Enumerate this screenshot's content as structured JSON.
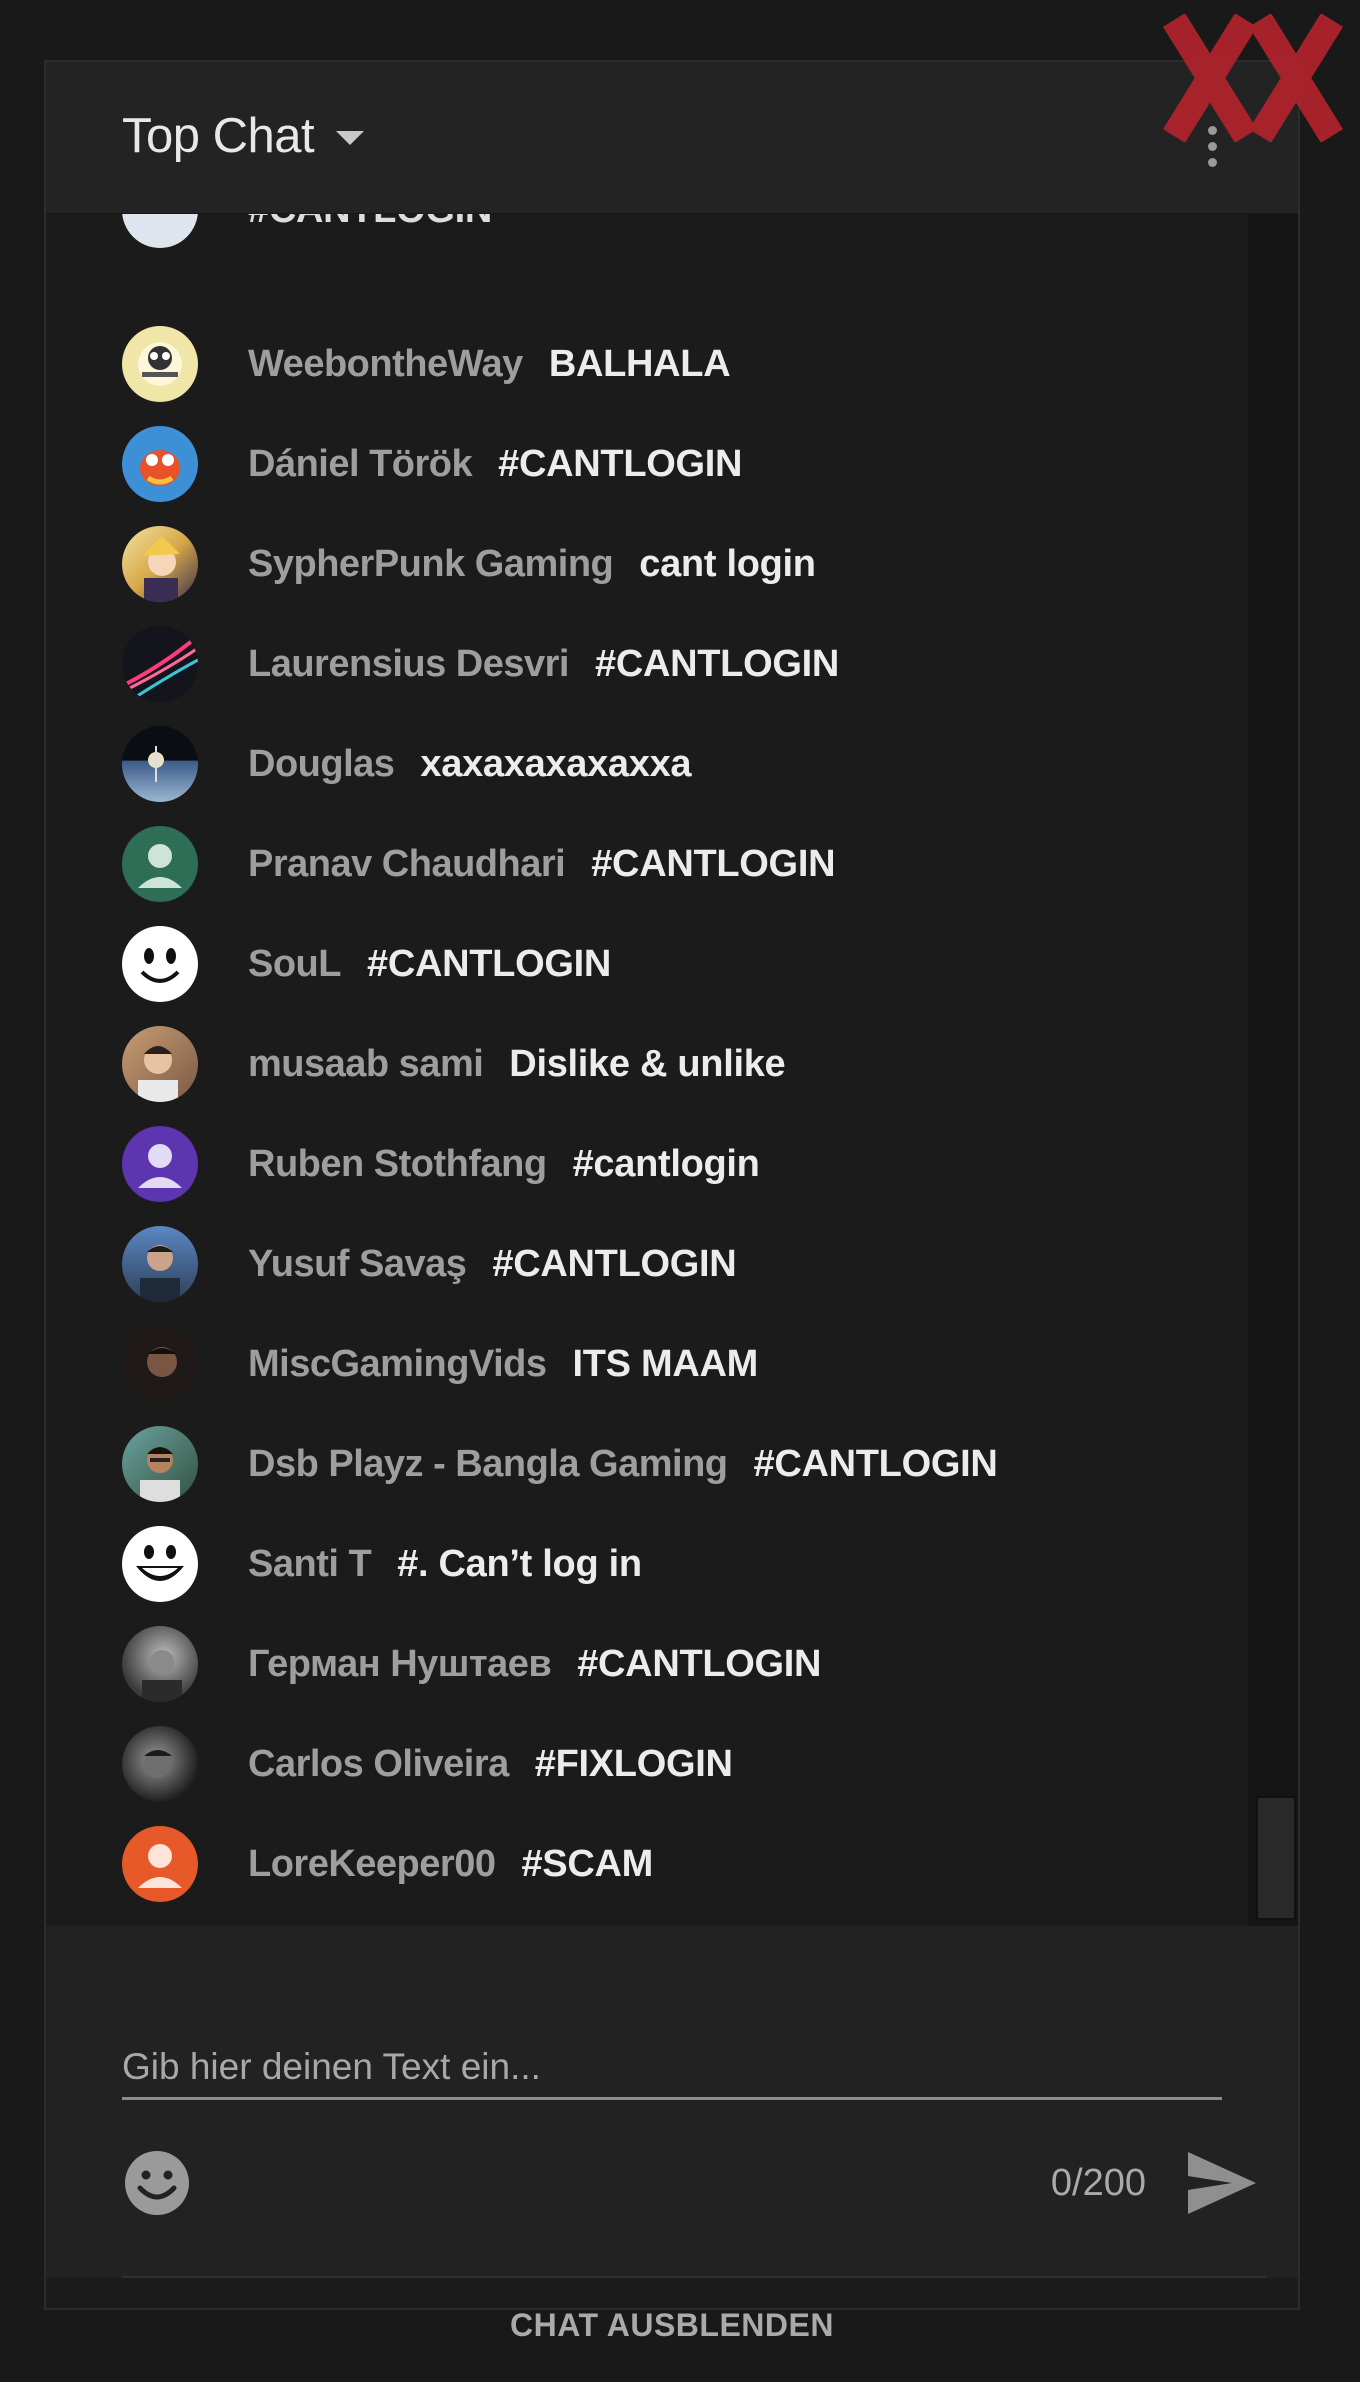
{
  "header": {
    "title": "Top Chat"
  },
  "messages": [
    {
      "author": "",
      "text": "#CANTLOGIN",
      "avatar": "white-avatar-partial"
    },
    {
      "author": "WeebontheWay",
      "text": "BALHALA",
      "avatar": "weeb-logo-avatar"
    },
    {
      "author": "Dániel Török",
      "text": "#CANTLOGIN",
      "avatar": "cartoon-character-avatar"
    },
    {
      "author": "SypherPunk Gaming",
      "text": "cant login",
      "avatar": "anime-character-avatar"
    },
    {
      "author": "Laurensius Desvri",
      "text": "#CANTLOGIN",
      "avatar": "neon-lines-avatar"
    },
    {
      "author": "Douglas",
      "text": "xaxaxaxaxaxxa",
      "avatar": "space-photo-avatar"
    },
    {
      "author": "Pranav Chaudhari",
      "text": "#CANTLOGIN",
      "avatar": "default-user-avatar-teal"
    },
    {
      "author": "SouL",
      "text": "#CANTLOGIN",
      "avatar": "smiley-face-avatar"
    },
    {
      "author": "musaab sami",
      "text": "Dislike & unlike",
      "avatar": "person-photo-avatar"
    },
    {
      "author": "Ruben Stothfang",
      "text": "#cantlogin",
      "avatar": "default-user-avatar-purple"
    },
    {
      "author": "Yusuf Savaş",
      "text": "#CANTLOGIN",
      "avatar": "person-photo-avatar"
    },
    {
      "author": "MiscGamingVids",
      "text": "ITS MAAM",
      "avatar": "person-photo-avatar"
    },
    {
      "author": "Dsb Playz - Bangla Gaming",
      "text": "#CANTLOGIN",
      "avatar": "person-photo-avatar"
    },
    {
      "author": "Santi T",
      "text": "#. Can’t log in",
      "avatar": "grin-face-avatar"
    },
    {
      "author": "Герман Нуштаев",
      "text": "#CANTLOGIN",
      "avatar": "grayscale-photo-avatar"
    },
    {
      "author": "Carlos Oliveira",
      "text": "#FIXLOGIN",
      "avatar": "grayscale-photo-avatar"
    },
    {
      "author": "LoreKeeper00",
      "text": "#SCAM",
      "avatar": "default-user-avatar-orange"
    }
  ],
  "input": {
    "placeholder": "Gib hier deinen Text ein...",
    "value": "",
    "counter": "0/200"
  },
  "footer": {
    "hide_chat_label": "CHAT AUSBLENDEN"
  },
  "colors": {
    "background": "#191919",
    "panel": "#1b1b1b",
    "header": "#232323",
    "author": "#9e9e9e",
    "message": "#ececec",
    "watermark": "#c0262f"
  }
}
